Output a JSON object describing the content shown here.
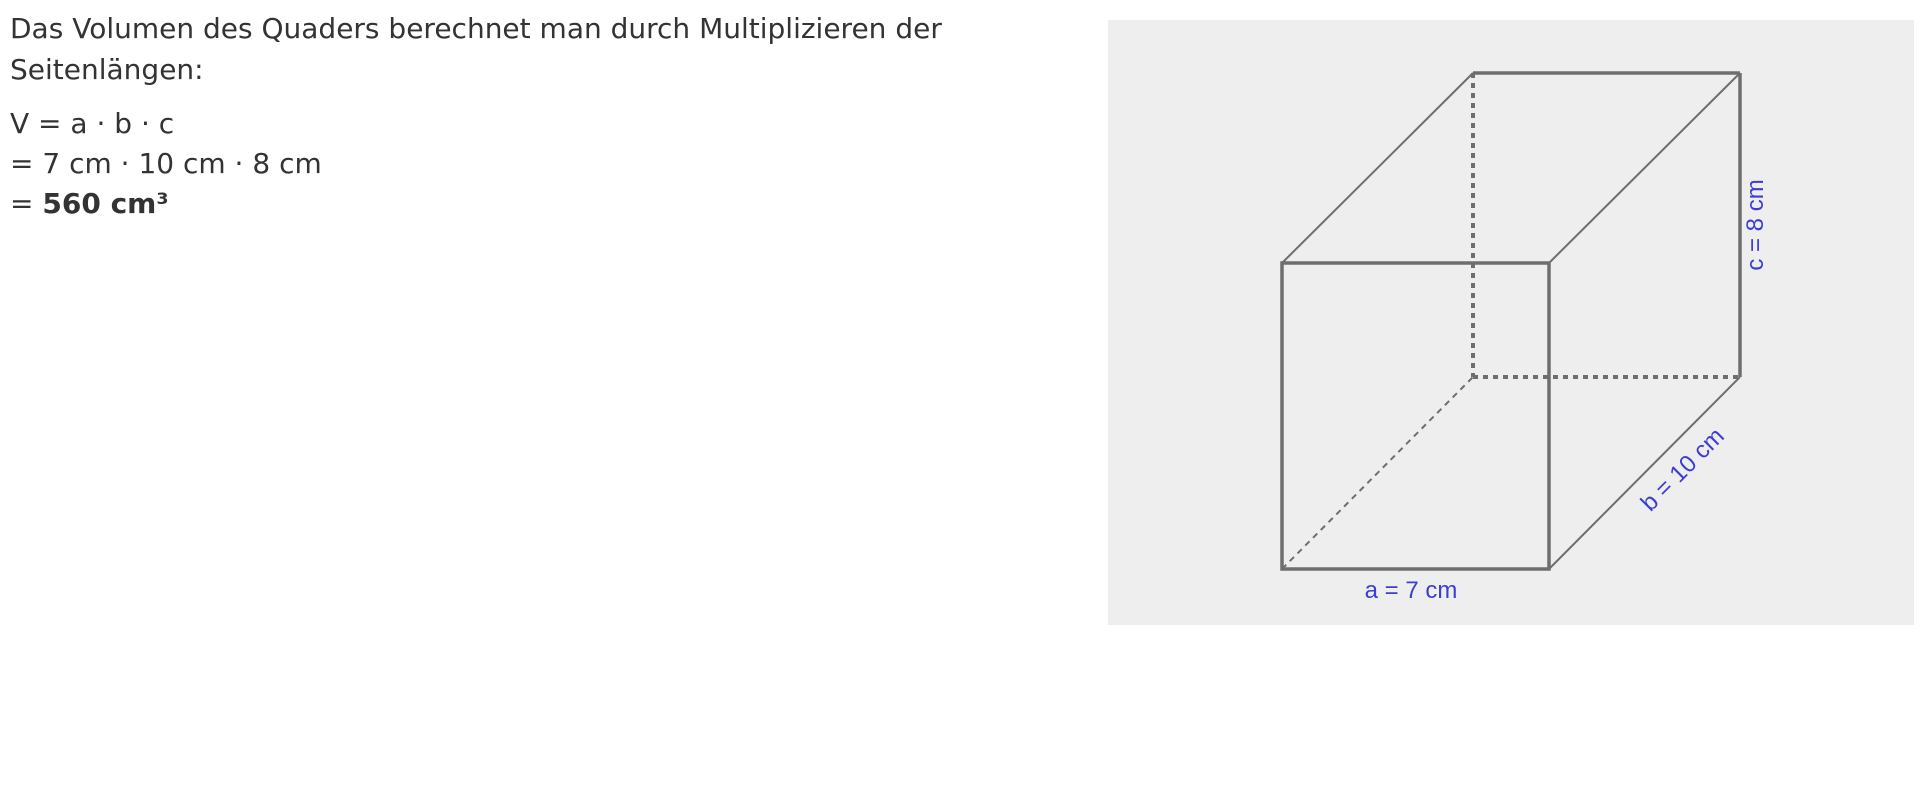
{
  "text": {
    "intro": "Das Volumen des Quaders berechnet man durch Multiplizieren der Seitenlängen:",
    "formula_line1": "V = a · b · c",
    "formula_line2": "= 7 cm · 10 cm · 8 cm",
    "formula_line3_prefix": "= ",
    "formula_result": "560 cm³"
  },
  "figure": {
    "label_a": "a = 7  cm",
    "label_b": "b = 10  cm",
    "label_c": "c = 8  cm",
    "colors": {
      "background": "#eeeeee",
      "edge": "#6e6e6e",
      "label": "#3d3dd6"
    }
  }
}
